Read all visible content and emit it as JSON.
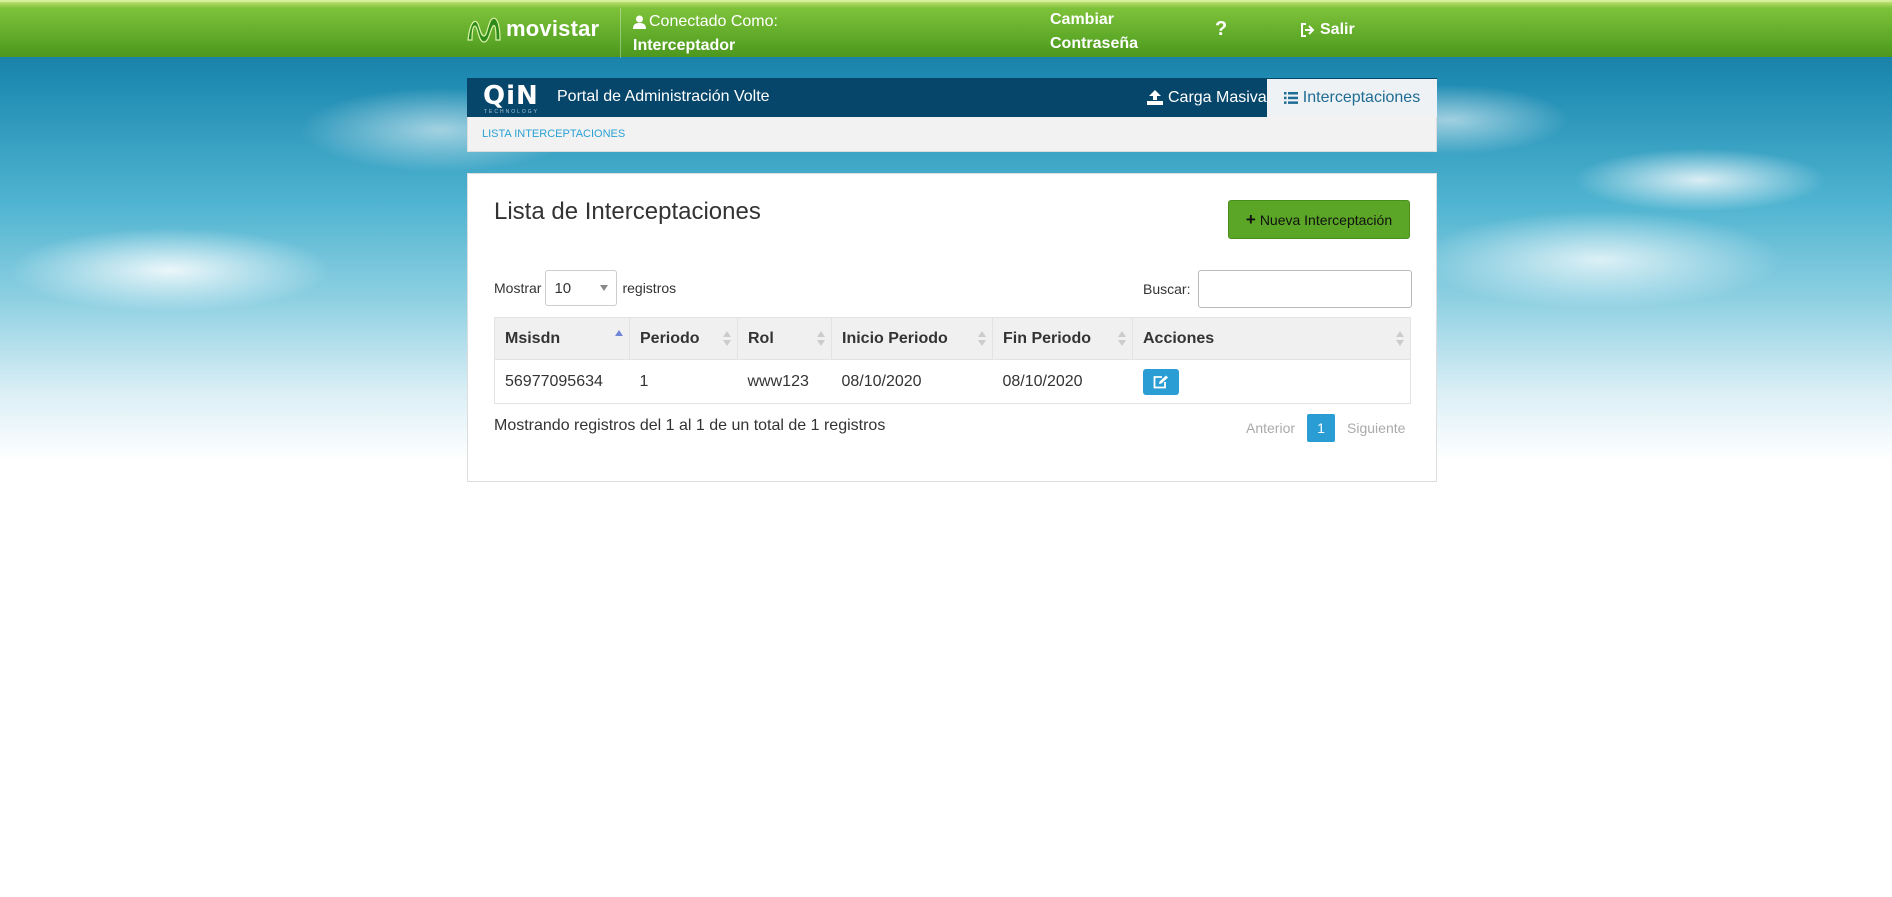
{
  "header": {
    "brand": "movistar",
    "connected_label": "Conectado Como:",
    "username": "Interceptador",
    "change_password_line1": "Cambiar",
    "change_password_line2": "Contraseña",
    "help": "?",
    "logout": "Salir"
  },
  "navbar": {
    "logo_word": "QiN",
    "logo_sub": "TECHNOLOGY",
    "title": "Portal de Administración Volte",
    "items": [
      {
        "label": "Carga Masiva",
        "icon": "upload-icon"
      },
      {
        "label": "Interceptaciones",
        "icon": "list-icon",
        "active": true
      }
    ]
  },
  "breadcrumb": "LISTA INTERCEPTACIONES",
  "main": {
    "title": "Lista de Interceptaciones",
    "new_button": "Nueva Interceptación",
    "length": {
      "prefix": "Mostrar",
      "value": "10",
      "suffix": "registros"
    },
    "search": {
      "label": "Buscar:",
      "value": ""
    },
    "table": {
      "columns": [
        "Msisdn",
        "Periodo",
        "Rol",
        "Inicio Periodo",
        "Fin Periodo",
        "Acciones"
      ],
      "rows": [
        [
          "56977095634",
          "1",
          "www123",
          "08/10/2020",
          "08/10/2020"
        ]
      ]
    },
    "info": "Mostrando registros del 1 al 1 de un total de 1 registros",
    "pagination": {
      "prev": "Anterior",
      "current": "1",
      "next": "Siguiente"
    }
  },
  "colors": {
    "topbar_green": "#5aa626",
    "navbar_blue": "#06466a",
    "accent_blue": "#2a9ed4",
    "button_green": "#5ba626"
  }
}
